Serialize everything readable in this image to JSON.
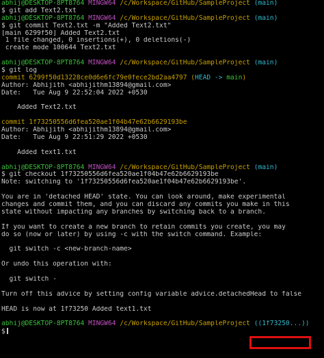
{
  "colors": {
    "background": "#000000",
    "text": "#cccccc",
    "prompt_user": "#3cc13c",
    "prompt_env": "#c050c0",
    "prompt_path": "#c8a000",
    "branch": "#33b8cc",
    "commit_hash": "#c8a000",
    "highlight_box": "#e01010"
  },
  "prompt": {
    "user_host": "abhij@DESKTOP-8PT8764",
    "env": "MINGW64",
    "path": "/c/Workspace/GitHub/SampleProject",
    "branch": "(main)",
    "symbol": "$"
  },
  "lines": {
    "l02": "$ git add Text2.txt",
    "l04": "$ git commit Text2.txt -m \"Added Text2.txt\"",
    "l05": "[main 6299f50] Added Text2.txt",
    "l06": " 1 file changed, 0 insertions(+), 0 deletions(-)",
    "l07": " create mode 100644 Text2.txt",
    "l10": "$ git log",
    "l11_hash": "commit 6299f50d13228ce0d6e6fc79e0fece2bd2aa4797",
    "l11_open": "(",
    "l11_head": "HEAD -> ",
    "l11_main": "main",
    "l11_close": ")",
    "l12": "Author: Abhijith <abhijithm13894@gmail.com>",
    "l13": "Date:   Tue Aug 9 22:52:04 2022 +0530",
    "l15": "    Added Text2.txt",
    "l17_hash": "commit 1f73250556d6fea520ae1f04b47e62b6629193be",
    "l18": "Author: Abhijith <abhijithm13894@gmail.com>",
    "l19": "Date:   Tue Aug 9 22:51:29 2022 +0530",
    "l21": "    Added text1.txt",
    "l24": "$ git checkout 1f73250556d6fea520ae1f04b47e62b6629193be",
    "l25": "Note: switching to '1f73250556d6fea520ae1f04b47e62b6629193be'.",
    "l27": "You are in 'detached HEAD' state. You can look around, make experimental",
    "l28": "changes and commit them, and you can discard any commits you make in this",
    "l29": "state without impacting any branches by switching back to a branch.",
    "l31": "If you want to create a new branch to retain commits you create, you may",
    "l32": "do so (now or later) by using -c with the switch command. Example:",
    "l34": "  git switch -c <new-branch-name>",
    "l36": "Or undo this operation with:",
    "l38": "  git switch -",
    "l40": "Turn off this advice by setting config variable advice.detachedHead to false",
    "l42": "HEAD is now at 1f73250 Added text1.txt",
    "l45": "$"
  },
  "last_prompt_branch": "((1f73250...))"
}
